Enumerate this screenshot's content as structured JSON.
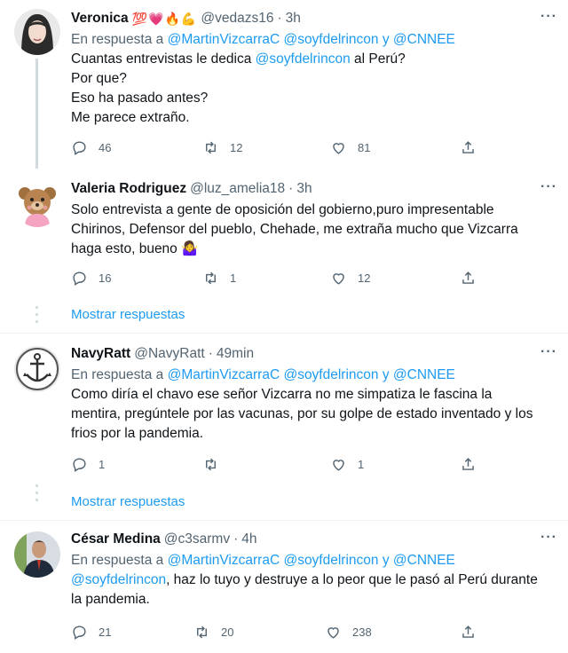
{
  "tweets": [
    {
      "name": "Veronica",
      "emoji": "💯💗🔥💪",
      "handle": "@vedazs16",
      "sep": "·",
      "time": "3h",
      "reply_prefix": "En respuesta a",
      "reply_users": [
        "@MartinVizcarraC",
        "@soyfdelrincon"
      ],
      "reply_and": "y",
      "reply_last": "@CNNEE",
      "text_line1_pre": "Cuantas entrevistas le dedica ",
      "text_line1_mention": "@soyfdelrincon",
      "text_line1_post": " al Perú?",
      "text_line2": "Por que?",
      "text_line3": "Eso ha pasado antes?",
      "text_line4": "Me parece extraño.",
      "replies": "46",
      "retweets": "12",
      "likes": "81"
    },
    {
      "name": "Valeria Rodriguez",
      "handle": "@luz_amelia18",
      "sep": "·",
      "time": "3h",
      "text_line1": "Solo entrevista a gente de oposición del gobierno,puro impresentable",
      "text_line2": "Chirinos, Defensor del pueblo, Chehade, me extraña mucho que Vizcarra",
      "text_line3": "haga esto, bueno 🤷‍♀️",
      "replies": "16",
      "retweets": "1",
      "likes": "12"
    },
    {
      "name": "NavyRatt",
      "handle": "@NavyRatt",
      "sep": "·",
      "time": "49min",
      "reply_prefix": "En respuesta a",
      "reply_users": [
        "@MartinVizcarraC",
        "@soyfdelrincon"
      ],
      "reply_and": "y",
      "reply_last": "@CNNEE",
      "text_line1": "Como diría el chavo ese señor Vizcarra no me simpatiza le fascina la",
      "text_line2": "mentira, pregúntele por las vacunas, por su golpe de estado inventado y los",
      "text_line3": "frios por la pandemia.",
      "replies": "1",
      "retweets": "",
      "likes": "1"
    },
    {
      "name": "César Medina",
      "handle": "@c3sarmv",
      "sep": "·",
      "time": "4h",
      "reply_prefix": "En respuesta a",
      "reply_users": [
        "@MartinVizcarraC",
        "@soyfdelrincon"
      ],
      "reply_and": "y",
      "reply_last": "@CNNEE",
      "text_line1_mention": "@soyfdelrincon",
      "text_line1_post": ", haz lo tuyo y destruye a lo peor que le pasó al Perú durante",
      "text_line2": "la pandemia.",
      "replies": "21",
      "retweets": "20",
      "likes": "238"
    }
  ],
  "show_replies_label": "Mostrar respuestas",
  "more_label": "···",
  "colors": {
    "accent": "#1d9bf0",
    "muted": "#536471",
    "text": "#0f1419",
    "divider": "#eff3f4"
  }
}
